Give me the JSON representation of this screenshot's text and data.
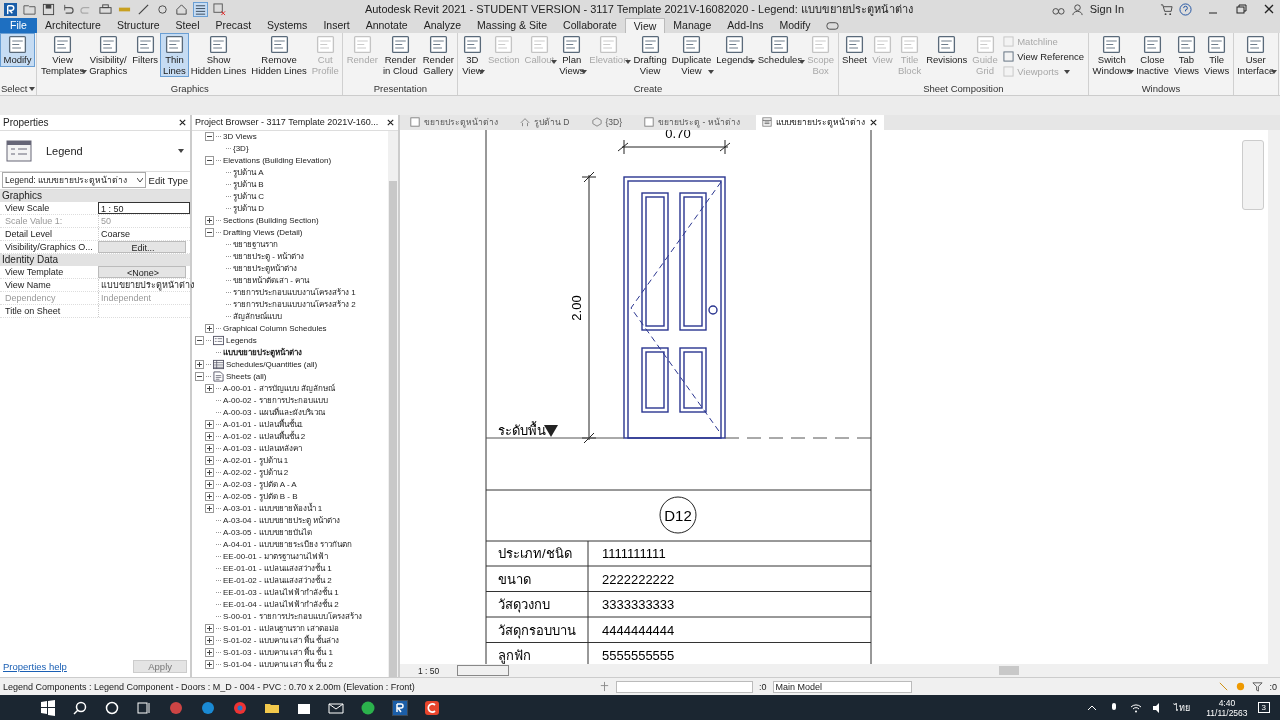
{
  "title_bar": {
    "title": "Autodesk Revit 2021 - STUDENT VERSION - 3117 Template 2021V-16082020 - Legend: แบบขยายประตูหน้าต่าง",
    "sign_in": "Sign In"
  },
  "ribbon_tabs": [
    {
      "label": "File",
      "selected": false,
      "kind": "file"
    },
    {
      "label": "Architecture",
      "selected": false,
      "kind": "tab"
    },
    {
      "label": "Structure",
      "selected": false,
      "kind": "tab"
    },
    {
      "label": "Steel",
      "selected": false,
      "kind": "tab"
    },
    {
      "label": "Precast",
      "selected": false,
      "kind": "tab"
    },
    {
      "label": "Systems",
      "selected": false,
      "kind": "tab"
    },
    {
      "label": "Insert",
      "selected": false,
      "kind": "tab"
    },
    {
      "label": "Annotate",
      "selected": false,
      "kind": "tab"
    },
    {
      "label": "Analyze",
      "selected": false,
      "kind": "tab"
    },
    {
      "label": "Massing & Site",
      "selected": false,
      "kind": "tab"
    },
    {
      "label": "Collaborate",
      "selected": false,
      "kind": "tab"
    },
    {
      "label": "View",
      "selected": true,
      "kind": "tab"
    },
    {
      "label": "Manage",
      "selected": false,
      "kind": "tab"
    },
    {
      "label": "Add-Ins",
      "selected": false,
      "kind": "tab"
    },
    {
      "label": "Modify",
      "selected": false,
      "kind": "tab"
    }
  ],
  "ribbon_panels": [
    {
      "title": "Select",
      "menu": true,
      "buttons": [
        {
          "label": "Modify",
          "kind": "large",
          "selected": true,
          "disabled": false,
          "dropdown": false
        }
      ]
    },
    {
      "title": "Graphics",
      "buttons": [
        {
          "label": "View\nTemplates",
          "kind": "large",
          "selected": false,
          "disabled": false,
          "dropdown": true
        },
        {
          "label": "Visibility/\nGraphics",
          "kind": "large",
          "selected": false,
          "disabled": false,
          "dropdown": false
        },
        {
          "label": "Filters",
          "kind": "large",
          "selected": false,
          "disabled": false,
          "dropdown": false
        },
        {
          "label": "Thin\nLines",
          "kind": "large",
          "selected": true,
          "disabled": false,
          "dropdown": false
        },
        {
          "label": "Show\nHidden Lines",
          "kind": "large",
          "selected": false,
          "disabled": false,
          "dropdown": false
        },
        {
          "label": "Remove\nHidden Lines",
          "kind": "large",
          "selected": false,
          "disabled": false,
          "dropdown": false
        },
        {
          "label": "Cut\nProfile",
          "kind": "large",
          "selected": false,
          "disabled": true,
          "dropdown": false
        }
      ]
    },
    {
      "title": "Presentation",
      "buttons": [
        {
          "label": "Render",
          "kind": "large",
          "selected": false,
          "disabled": true,
          "dropdown": false
        },
        {
          "label": "Render\nin Cloud",
          "kind": "large",
          "selected": false,
          "disabled": false,
          "dropdown": false
        },
        {
          "label": "Render\nGallery",
          "kind": "large",
          "selected": false,
          "disabled": false,
          "dropdown": false
        }
      ]
    },
    {
      "title": "Create",
      "buttons": [
        {
          "label": "3D\nView",
          "kind": "large",
          "selected": false,
          "disabled": false,
          "dropdown": true
        },
        {
          "label": "Section",
          "kind": "large",
          "selected": false,
          "disabled": true,
          "dropdown": false
        },
        {
          "label": "Callout",
          "kind": "large",
          "selected": false,
          "disabled": true,
          "dropdown": true
        },
        {
          "label": "Plan\nViews",
          "kind": "large",
          "selected": false,
          "disabled": false,
          "dropdown": true
        },
        {
          "label": "Elevation",
          "kind": "large",
          "selected": false,
          "disabled": true,
          "dropdown": true
        },
        {
          "label": "Drafting\nView",
          "kind": "large",
          "selected": false,
          "disabled": false,
          "dropdown": false
        },
        {
          "label": "Duplicate\nView",
          "kind": "large",
          "selected": false,
          "disabled": false,
          "dropdown": true
        },
        {
          "label": "Legends",
          "kind": "large",
          "selected": false,
          "disabled": false,
          "dropdown": true
        },
        {
          "label": "Schedules",
          "kind": "large",
          "selected": false,
          "disabled": false,
          "dropdown": true
        },
        {
          "label": "Scope\nBox",
          "kind": "large",
          "selected": false,
          "disabled": true,
          "dropdown": false
        }
      ]
    },
    {
      "title": "Sheet Composition",
      "buttons": [
        {
          "label": "Sheet",
          "kind": "large",
          "selected": false,
          "disabled": false,
          "dropdown": false
        },
        {
          "label": "View",
          "kind": "large",
          "selected": false,
          "disabled": true,
          "dropdown": false
        },
        {
          "label": "Title\nBlock",
          "kind": "large",
          "selected": false,
          "disabled": true,
          "dropdown": false
        },
        {
          "label": "Revisions",
          "kind": "large",
          "selected": false,
          "disabled": false,
          "dropdown": false
        },
        {
          "label": "Guide\nGrid",
          "kind": "large",
          "selected": false,
          "disabled": true,
          "dropdown": false
        },
        {
          "label": "Matchline",
          "kind": "small",
          "selected": false,
          "disabled": true,
          "dropdown": false
        },
        {
          "label": "View  Reference",
          "kind": "small",
          "selected": false,
          "disabled": false,
          "dropdown": false
        },
        {
          "label": "Viewports",
          "kind": "small",
          "selected": false,
          "disabled": true,
          "dropdown": true
        }
      ]
    },
    {
      "title": "Windows",
      "buttons": [
        {
          "label": "Switch\nWindows",
          "kind": "large",
          "selected": false,
          "disabled": false,
          "dropdown": true
        },
        {
          "label": "Close\nInactive",
          "kind": "large",
          "selected": false,
          "disabled": false,
          "dropdown": false
        },
        {
          "label": "Tab\nViews",
          "kind": "large",
          "selected": false,
          "disabled": false,
          "dropdown": false
        },
        {
          "label": "Tile\nViews",
          "kind": "large",
          "selected": false,
          "disabled": false,
          "dropdown": false
        }
      ]
    },
    {
      "buttons": [
        {
          "label": "User\nInterface",
          "kind": "large",
          "selected": false,
          "disabled": false,
          "dropdown": true
        }
      ]
    }
  ],
  "properties": {
    "title": "Properties",
    "type_name": "Legend",
    "type_selector": "Legend: แบบขยายประตูหน้าต่าง",
    "edit_type": "Edit Type",
    "groups": [
      {
        "name": "Graphics",
        "rows": [
          {
            "name": "View Scale",
            "value": "1 : 50",
            "kind": "input",
            "disabled": false
          },
          {
            "name": "Scale Value    1:",
            "value": "50",
            "kind": "text",
            "disabled": true
          },
          {
            "name": "Detail Level",
            "value": "Coarse",
            "kind": "text",
            "disabled": false
          },
          {
            "name": "Visibility/Graphics O...",
            "value": "Edit...",
            "kind": "button",
            "disabled": false
          }
        ]
      },
      {
        "name": "Identity Data",
        "rows": [
          {
            "name": "View Template",
            "value": "<None>",
            "kind": "button",
            "disabled": false
          },
          {
            "name": "View Name",
            "value": "แบบขยายประตูหน้าต่าง",
            "kind": "text",
            "disabled": false
          },
          {
            "name": "Dependency",
            "value": "Independent",
            "kind": "text",
            "disabled": true
          },
          {
            "name": "Title on Sheet",
            "kind": "text",
            "disabled": false
          }
        ]
      }
    ],
    "help": "Properties help",
    "apply": "Apply",
    "apply_disabled": true
  },
  "browser": {
    "title": "Project Browser - 3117 Template 2021V-160...",
    "partial_group": [
      {
        "label": "3D Views",
        "expanded": true,
        "selected": false,
        "children": [
          {
            "label": "{3D}",
            "selected": false
          }
        ]
      },
      {
        "label": "Elevations (Building Elevation)",
        "expanded": true,
        "selected": false,
        "children": [
          {
            "label": "รูปด้าน A",
            "selected": false
          },
          {
            "label": "รูปด้าน B",
            "selected": false
          },
          {
            "label": "รูปด้าน C",
            "selected": false
          },
          {
            "label": "รูปด้าน D",
            "selected": false
          }
        ]
      },
      {
        "label": "Sections (Building Section)",
        "expanded": false,
        "selected": false
      },
      {
        "label": "Drafting Views (Detail)",
        "expanded": true,
        "selected": false,
        "children": [
          {
            "label": "ขยายฐานราก",
            "selected": false
          },
          {
            "label": "ขยายประตู - หน้าต่าง",
            "selected": false
          },
          {
            "label": "ขยายประตูหน้าต่าง",
            "selected": false
          },
          {
            "label": "ขยายหน้าตัดเสา - คาน",
            "selected": false
          },
          {
            "label": "รายการประกอบแบบงานโครงสร้าง 1",
            "selected": false
          },
          {
            "label": "รายการประกอบแบบงานโครงสร้าง 2",
            "selected": false
          },
          {
            "label": "สัญลักษณ์แบบ",
            "selected": false
          }
        ]
      },
      {
        "label": "Graphical Column Schedules",
        "expanded": false,
        "selected": false
      }
    ],
    "tree": [
      {
        "label": "Legends",
        "kind": "legend",
        "expanded": true,
        "selected": false,
        "children": [
          {
            "label": "แบบขยายประตูหน้าต่าง",
            "selected": true
          }
        ]
      },
      {
        "label": "Schedules/Quantities (all)",
        "kind": "schedule",
        "expanded": false,
        "selected": false
      },
      {
        "label": "Sheets (all)",
        "kind": "sheet",
        "expanded": true,
        "selected": false,
        "children": [
          {
            "label": "A-00-01 - สารบัญแบบ สัญลักษณ์",
            "expanded": false,
            "selected": false
          },
          {
            "label": "A-00-02 - รายการประกอบแบบ",
            "selected": false
          },
          {
            "label": "A-00-03 - แผนที่และผังบริเวณ",
            "selected": false
          },
          {
            "label": "A-01-01 - แปลนพื้นชั้น1",
            "expanded": false,
            "selected": false
          },
          {
            "label": "A-01-02 - แปลนพื้นชั้น 2",
            "expanded": false,
            "selected": false
          },
          {
            "label": "A-01-03 - แปลนหลังคา",
            "expanded": false,
            "selected": false
          },
          {
            "label": "A-02-01 - รูปด้าน 1",
            "expanded": false,
            "selected": false
          },
          {
            "label": "A-02-02 - รูปด้าน 2",
            "expanded": false,
            "selected": false
          },
          {
            "label": "A-02-03 - รูปตัด A - A",
            "expanded": false,
            "selected": false
          },
          {
            "label": "A-02-05 - รูปตัด B - B",
            "expanded": false,
            "selected": false
          },
          {
            "label": "A-03-01 - แบบขยายห้องน้ำ 1",
            "expanded": false,
            "selected": false
          },
          {
            "label": "A-03-04 - แบบขยายประตู หน้าต่าง",
            "selected": false
          },
          {
            "label": "A-03-05 - แบบขยายบันได",
            "selected": false
          },
          {
            "label": "A-04-01 - แบบขยายระเบียง ราวกันตก",
            "selected": false
          },
          {
            "label": "EE-00-01 - มาตรฐานงานไฟฟ้า",
            "selected": false
          },
          {
            "label": "EE-01-01 - แปลนแสงสว่างชั้น 1",
            "selected": false
          },
          {
            "label": "EE-01-02 - แปลนแสงสว่างชั้น 2",
            "selected": false
          },
          {
            "label": "EE-01-03 - แปลนไฟฟ้ากำลังชั้น 1",
            "selected": false
          },
          {
            "label": "EE-01-04 - แปลนไฟฟ้ากำลังชั้น 2",
            "selected": false
          },
          {
            "label": "S-00-01 - รายการประกอบแบบโครงสร้าง",
            "selected": false
          },
          {
            "label": "S-01-01 - แปลนฐานราก เสาตอม่อ",
            "expanded": false,
            "selected": false
          },
          {
            "label": "S-01-02 - แบบคาน เสา พื้น ชั้นล่าง",
            "expanded": false,
            "selected": false
          },
          {
            "label": "S-01-03 - แบบคาน เสา พื้น ชั้น 1",
            "expanded": false,
            "selected": false
          },
          {
            "label": "S-01-04 - แบบคาน เสา พื้น ชั้น 2",
            "expanded": false,
            "selected": false
          }
        ]
      }
    ]
  },
  "view_tabs": [
    {
      "label": "ขยายประตูหน้าต่าง",
      "kind": "drafting",
      "selected": false
    },
    {
      "label": "รูปด้าน D",
      "kind": "elevation",
      "selected": false
    },
    {
      "label": "{3D}",
      "kind": "model",
      "selected": false
    },
    {
      "label": "ขยายประตู - หน้าต่าง",
      "kind": "drafting",
      "selected": false
    },
    {
      "label": "แบบขยายประตูหน้าต่าง",
      "kind": "legend",
      "selected": true
    }
  ],
  "canvas": {
    "width_dim": "0.70",
    "height_dim": "2.00",
    "level_label": "ระดับพื้น",
    "tag": "D12",
    "rows": [
      {
        "label": "ประเภท/ชนิด",
        "value": "1111111111"
      },
      {
        "label": "ขนาด",
        "value": "2222222222"
      },
      {
        "label": "วัสดุวงกบ",
        "value": "3333333333"
      },
      {
        "label": "วัสดุกรอบบาน",
        "value": "4444444444"
      },
      {
        "label": "ลูกฟัก",
        "value": "5555555555"
      }
    ]
  },
  "view_control": {
    "scale": "1 : 50"
  },
  "status_bar": {
    "text": "Legend Components : Legend Component - Doors : M_D - 004 - PVC : 0.70 x 2.00m (Elevation : Front)",
    "select_count": ":0",
    "model": "Main Model",
    "filter_count": ":0"
  },
  "taskbar": {
    "language": "ไทย",
    "time": "4:40",
    "date": "11/11/2563",
    "notifications": "3"
  }
}
